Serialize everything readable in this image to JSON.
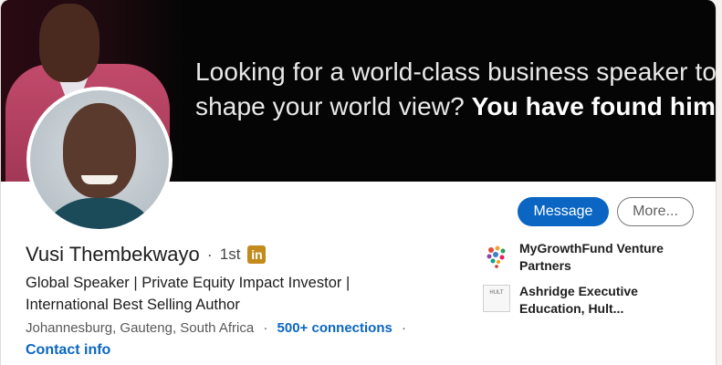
{
  "banner": {
    "line1": "Looking for a world-class business speaker to",
    "line2_plain": "shape your world view? ",
    "line2_bold": "You have found him."
  },
  "actions": {
    "message_label": "Message",
    "more_label": "More..."
  },
  "profile": {
    "name": "Vusi Thembekwayo",
    "separator": "·",
    "degree": "1st",
    "linkedin_badge": "in",
    "headline": "Global Speaker | Private Equity Impact Investor | International Best Selling Author",
    "location": "Johannesburg, Gauteng, South Africa",
    "connections": "500+ connections",
    "contact_info": "Contact info"
  },
  "experience": [
    {
      "label": "MyGrowthFund Venture Partners",
      "icon": "mygrowthfund-logo-icon"
    },
    {
      "label": "Ashridge Executive Education, Hult...",
      "icon": "hult-logo-icon",
      "logo_text": "HULT"
    }
  ],
  "colors": {
    "primary": "#0a66c2",
    "badge": "#c38a1c",
    "banner_bg": "#050505"
  }
}
